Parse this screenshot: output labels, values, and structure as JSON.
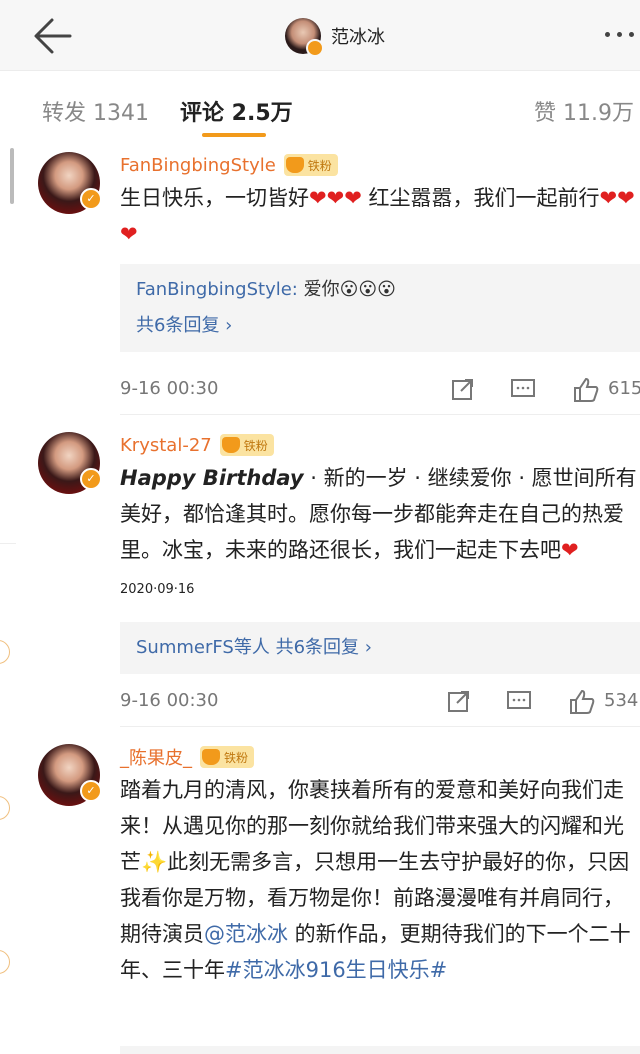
{
  "header": {
    "title": "范冰冰",
    "icons": {
      "back": "back-arrow-icon",
      "more": "more-dots-icon"
    }
  },
  "tabs": {
    "repost": "转发 1341",
    "comments": "评论 2.5万",
    "likes": "赞 11.9万"
  },
  "colors": {
    "accent": "#f29a1b",
    "username": "#e8712e",
    "link": "#3f6aa8",
    "heart": "#e02020"
  },
  "comments": [
    {
      "user": "FanBingbingStyle",
      "badge": "铁粉",
      "text_a": "生日快乐，一切皆好",
      "hearts_a": "❤❤❤",
      "text_b": " 红尘嚣嚣，我们一起前行",
      "hearts_b": "❤❤❤",
      "reply_user": "FanBingbingStyle:",
      "reply_text": " 爱你",
      "reply_emoji": "😮😮😮",
      "reply_more": "共6条回复 ›",
      "time": "9-16 00:30",
      "likes": "615"
    },
    {
      "user": "Krystal-27",
      "badge": "铁粉",
      "hb": "Happy Birthday",
      "text": " · 新的一岁 · 继续爱你 · 愿世间所有美好，都恰逢其时。愿你每一步都能奔走在自己的热爱里。冰宝，未来的路还很长，我们一起走下去吧",
      "heart": "❤",
      "date": "2020·09·16",
      "reply_names": "SummerFS等人",
      "reply_more": " 共6条回复 ›",
      "time": "9-16 00:30",
      "likes": "534"
    },
    {
      "user": "_陈果皮_",
      "badge": "铁粉",
      "text_a": "踏着九月的清风，你裹挟着所有的爱意和美好向我们走来！从遇见你的那一刻你就给我们带来强大的闪耀和光芒",
      "sparkle": "✨",
      "text_b": "此刻无需多言，只想用一生去守护最好的你，只因我看你是万物，看万物是你！前路漫漫唯有并肩同行，期待演员",
      "mention": "@范冰冰",
      "text_c": " 的新作品，更期待我们的下一个二十年、三十年",
      "hashtag": "#范冰冰916生日快乐#"
    }
  ]
}
